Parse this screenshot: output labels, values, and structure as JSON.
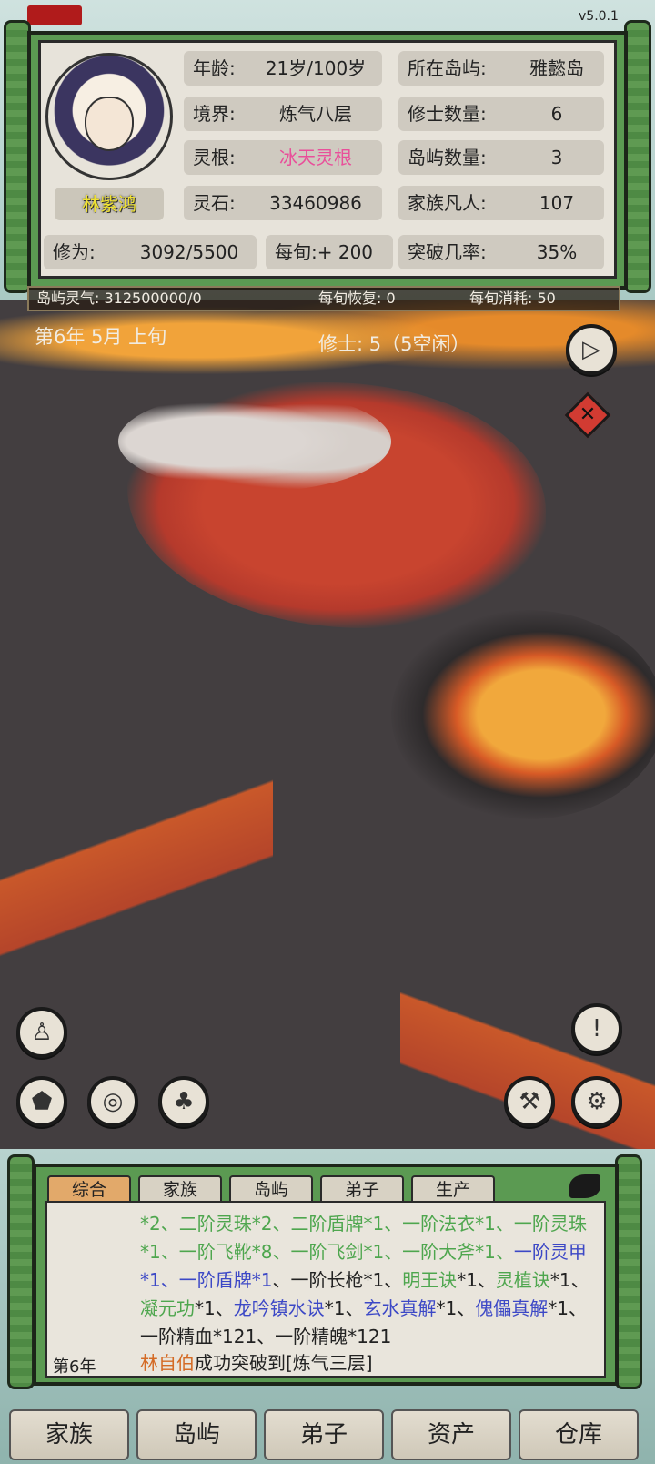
{
  "version": "v5.0.1",
  "character": {
    "name": "林紫鸿",
    "cultivation_label": "修为:",
    "cultivation_value": "3092/5500",
    "per_turn": "每旬:+ 200"
  },
  "stats": [
    {
      "key": "年龄:",
      "value": "21岁/100岁"
    },
    {
      "key": "境界:",
      "value": "炼气八层"
    },
    {
      "key": "灵根:",
      "value": "冰天灵根"
    },
    {
      "key": "灵石:",
      "value": "33460986"
    },
    {
      "key": "所在岛屿:",
      "value": "雅懿岛"
    },
    {
      "key": "修士数量:",
      "value": "6"
    },
    {
      "key": "岛屿数量:",
      "value": "3"
    },
    {
      "key": "家族凡人:",
      "value": "107"
    },
    {
      "key": "突破几率:",
      "value": "35%"
    }
  ],
  "spirit_bar": {
    "island_qi": "岛屿灵气: 312500000/0",
    "recovery": "每旬恢复: 0",
    "consumption": "每旬消耗: 50"
  },
  "date": "第6年 5月 上旬",
  "cultivators": "修士: 5（5空闲）",
  "map_buttons": [
    "play-icon",
    "close-icon",
    "person-icon",
    "exclamation-icon",
    "stone-icon",
    "refine-icon",
    "plant-icon",
    "hammer-icon",
    "gear-icon"
  ],
  "log": {
    "tabs": [
      "综合",
      "家族",
      "岛屿",
      "弟子",
      "生产"
    ],
    "active_tab": "综合",
    "year": "第6年",
    "lines_parts": [
      {
        "t": "*2、二阶灵珠*2、二阶盾牌*1、一阶法衣*1、一阶",
        "c": "g"
      },
      {
        "t": "灵珠*1、一阶飞靴*8、一阶飞剑*1、一阶大斧*1、",
        "c": "g"
      },
      {
        "t": "一阶灵甲*1、一阶盾牌*1",
        "c": "b"
      },
      {
        "t": "、一阶长枪*1、",
        "c": ""
      },
      {
        "t": "明王诀",
        "c": "g"
      },
      {
        "t": "*1、",
        "c": ""
      },
      {
        "t": "灵植诀",
        "c": "g"
      },
      {
        "t": "*1、",
        "c": ""
      },
      {
        "t": "凝元功",
        "c": "g"
      },
      {
        "t": "*1、",
        "c": ""
      },
      {
        "t": "龙吟镇水诀",
        "c": "b"
      },
      {
        "t": "*1、",
        "c": ""
      },
      {
        "t": "玄水真解",
        "c": "b"
      },
      {
        "t": "*1、",
        "c": ""
      },
      {
        "t": "傀儡真解",
        "c": "b"
      },
      {
        "t": "*1、一阶精血*121、一阶精魄*121",
        "c": ""
      }
    ],
    "last_name": "林自伯",
    "last_text": "成功突破到[炼气三层]"
  },
  "nav": [
    "家族",
    "岛屿",
    "弟子",
    "资产",
    "仓库"
  ],
  "colors": {
    "frame_green": "#5b9a52",
    "root_pink": "#e94f9a",
    "name_yellow": "#f0e233",
    "active_tab": "#e2a96a"
  }
}
